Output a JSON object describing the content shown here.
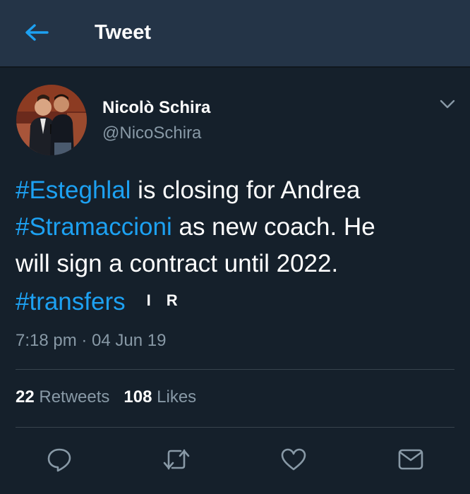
{
  "header": {
    "title": "Tweet",
    "back_icon": "arrow-left-icon"
  },
  "author": {
    "display_name": "Nicolò Schira",
    "handle": "@NicoSchira"
  },
  "tweet": {
    "lines": [
      [
        {
          "text": "#Esteghlal",
          "type": "hashtag"
        },
        {
          "text": " is closing for Andrea",
          "type": "text"
        }
      ],
      [
        {
          "text": "#Stramaccioni",
          "type": "hashtag"
        },
        {
          "text": " as new coach. He",
          "type": "text"
        }
      ],
      [
        {
          "text": "will sign a contract until 2022.",
          "type": "text"
        }
      ],
      [
        {
          "text": "#transfers",
          "type": "hashtag"
        }
      ]
    ],
    "badge_letters": [
      "I",
      "R"
    ],
    "timestamp": "7:18 pm · 04 Jun 19"
  },
  "stats": {
    "retweets_count": "22",
    "retweets_label": "Retweets",
    "likes_count": "108",
    "likes_label": "Likes"
  },
  "actions": [
    {
      "icon": "reply-icon"
    },
    {
      "icon": "retweet-icon"
    },
    {
      "icon": "heart-icon"
    },
    {
      "icon": "message-icon"
    }
  ],
  "colors": {
    "background": "#15202b",
    "header": "#243447",
    "accent": "#1da1f2",
    "secondary_text": "#8899a6",
    "divider": "#38444d"
  }
}
